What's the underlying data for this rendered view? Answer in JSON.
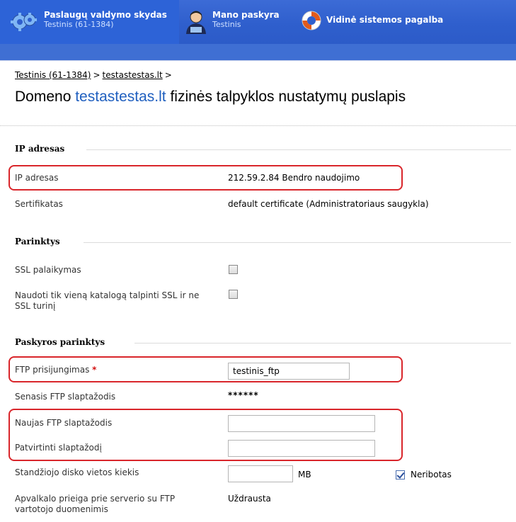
{
  "header": {
    "nav": [
      {
        "title": "Paslaugų valdymo skydas",
        "subtitle": "Testinis (61-1384)"
      },
      {
        "title": "Mano paskyra",
        "subtitle": "Testinis"
      },
      {
        "title": "Vidinė sistemos pagalba",
        "subtitle": ""
      }
    ]
  },
  "breadcrumb": {
    "items": [
      "Testinis (61-1384)",
      "testastestas.lt"
    ],
    "separator": ">"
  },
  "page_title": {
    "prefix": "Domeno ",
    "domain": "testastestas.lt",
    "suffix": " fizinės talpyklos nustatymų puslapis"
  },
  "sections": {
    "ip": {
      "title": "IP adresas",
      "ip_label": "IP adresas",
      "ip_value": "212.59.2.84 Bendro naudojimo",
      "cert_label": "Sertifikatas",
      "cert_value": "default certificate (Administratoriaus saugykla)"
    },
    "options": {
      "title": "Parinktys",
      "ssl_label": "SSL palaikymas",
      "ssl_checked": false,
      "single_dir_label": "Naudoti tik vieną katalogą talpinti SSL ir ne SSL turinį",
      "single_dir_checked": false
    },
    "account": {
      "title": "Paskyros parinktys",
      "ftp_login_label": "FTP prisijungimas",
      "required_mark": "*",
      "ftp_login_value": "testinis_ftp",
      "old_pass_label": "Senasis FTP slaptažodis",
      "old_pass_value": "******",
      "new_pass_label": "Naujas FTP slaptažodis",
      "confirm_pass_label": "Patvirtinti slaptažodį",
      "disk_label": "Standžiojo disko vietos kiekis",
      "disk_unit": "MB",
      "unlimited_label": "Neribotas",
      "unlimited_checked": true,
      "shell_label": "Apvalkalo prieiga prie serverio su FTP vartotojo duomenimis",
      "shell_value": "Uždrausta"
    }
  },
  "colors": {
    "header_blue": "#2f5fcd",
    "domain_link": "#1f5fbf",
    "highlight_red": "#d9262b",
    "required_red": "#d21010"
  }
}
